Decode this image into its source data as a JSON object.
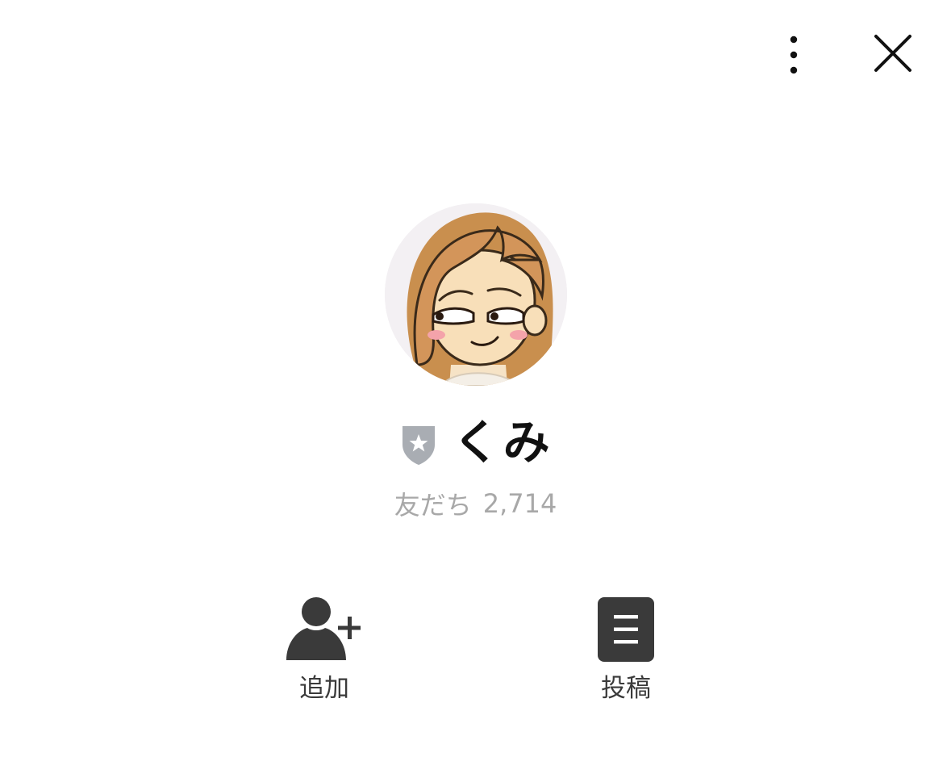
{
  "header": {
    "more_icon": "more-vertical-icon",
    "close_icon": "close-icon"
  },
  "profile": {
    "avatar_icon": "avatar-illustration",
    "badge_icon": "shield-star-icon",
    "badge_color": "#a9adb3",
    "name": "くみ",
    "friends_label": "友だち",
    "friends_count": "2,714"
  },
  "actions": [
    {
      "icon": "add-friend-icon",
      "label": "追加"
    },
    {
      "icon": "post-list-icon",
      "label": "投稿"
    }
  ],
  "colors": {
    "icon_dark": "#3a3a3a",
    "text_secondary": "#a8a8a8"
  }
}
